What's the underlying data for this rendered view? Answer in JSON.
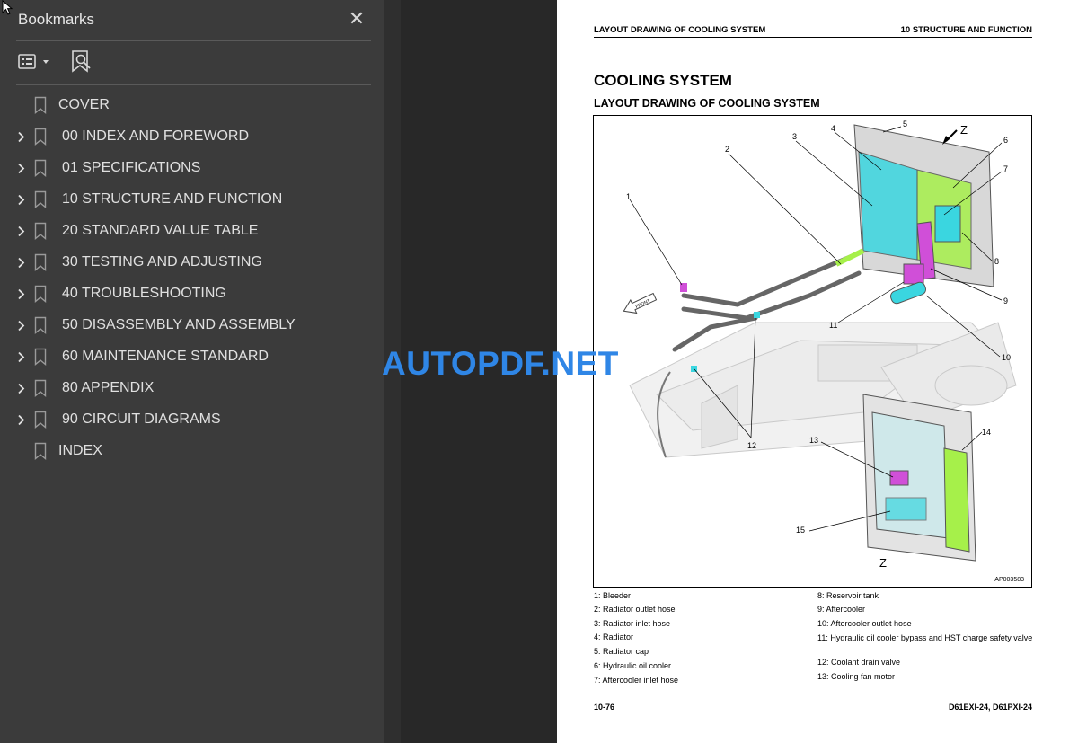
{
  "sidebar": {
    "title": "Bookmarks",
    "close_glyph": "✕",
    "items": [
      {
        "label": "COVER",
        "expandable": false
      },
      {
        "label": "00 INDEX AND FOREWORD",
        "expandable": true
      },
      {
        "label": "01 SPECIFICATIONS",
        "expandable": true
      },
      {
        "label": "10 STRUCTURE AND FUNCTION",
        "expandable": true
      },
      {
        "label": "20 STANDARD VALUE TABLE",
        "expandable": true
      },
      {
        "label": "30 TESTING AND ADJUSTING",
        "expandable": true
      },
      {
        "label": "40 TROUBLESHOOTING",
        "expandable": true
      },
      {
        "label": "50 DISASSEMBLY AND ASSEMBLY",
        "expandable": true
      },
      {
        "label": "60 MAINTENANCE STANDARD",
        "expandable": true
      },
      {
        "label": "80 APPENDIX",
        "expandable": true
      },
      {
        "label": "90 CIRCUIT DIAGRAMS",
        "expandable": true
      },
      {
        "label": "INDEX",
        "expandable": false
      }
    ]
  },
  "watermark": "AUTOPDF.NET",
  "page": {
    "header_left": "LAYOUT DRAWING OF COOLING SYSTEM",
    "header_right": "10 STRUCTURE AND FUNCTION",
    "title": "COOLING SYSTEM",
    "subtitle": "LAYOUT DRAWING OF COOLING SYSTEM",
    "figure_id": "AP003583",
    "front_label": "FRONT",
    "view_label": "Z",
    "callouts": [
      "1",
      "2",
      "3",
      "4",
      "5",
      "6",
      "7",
      "8",
      "9",
      "10",
      "11",
      "12",
      "13",
      "14",
      "15"
    ],
    "legend_left": [
      "1: Bleeder",
      "2: Radiator outlet hose",
      "3: Radiator inlet hose",
      "4: Radiator",
      "5: Radiator cap",
      "6: Hydraulic oil cooler",
      "7: Aftercooler inlet hose"
    ],
    "legend_right": [
      "8: Reservoir tank",
      "9: Aftercooler",
      "10: Aftercooler outlet hose",
      "11: Hydraulic oil cooler bypass and HST charge safety valve",
      "12: Coolant drain valve",
      "13: Cooling fan motor"
    ],
    "footer_left": "10-76",
    "footer_right": "D61EXI-24, D61PXI-24"
  },
  "colors": {
    "sidebar_bg": "#3b3b3b",
    "watermark": "#2f86e6",
    "highlight_magenta": "#d04fd8",
    "highlight_cyan": "#3ad6e0",
    "highlight_green": "#a6f04a"
  }
}
